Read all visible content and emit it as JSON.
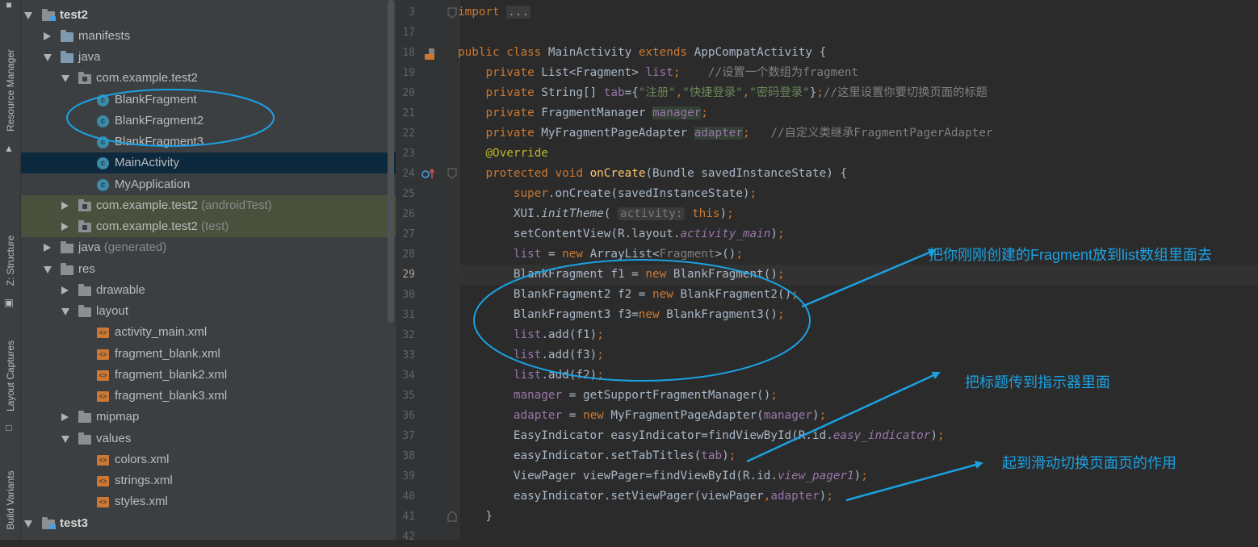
{
  "side_tabs": {
    "resource_manager": "Resource Manager",
    "structure": "Z: Structure",
    "layout_captures": "Layout Captures",
    "build_variants": "Build Variants"
  },
  "tree": {
    "items": [
      {
        "label": "test2",
        "suffix": "",
        "icon": "module-folder-icon"
      },
      {
        "label": "manifests",
        "suffix": "",
        "icon": "folder-icon"
      },
      {
        "label": "java",
        "suffix": "",
        "icon": "folder-icon"
      },
      {
        "label": "com.example.test2",
        "suffix": "",
        "icon": "package-icon"
      },
      {
        "label": "BlankFragment",
        "suffix": "",
        "icon": "class-icon"
      },
      {
        "label": "BlankFragment2",
        "suffix": "",
        "icon": "class-icon"
      },
      {
        "label": "BlankFragment3",
        "suffix": "",
        "icon": "class-icon"
      },
      {
        "label": "MainActivity",
        "suffix": "",
        "icon": "class-icon"
      },
      {
        "label": "MyApplication",
        "suffix": "",
        "icon": "class-icon"
      },
      {
        "label": "com.example.test2",
        "suffix": "(androidTest)",
        "icon": "package-icon"
      },
      {
        "label": "com.example.test2",
        "suffix": "(test)",
        "icon": "package-icon"
      },
      {
        "label": "java",
        "suffix": "(generated)",
        "icon": "generated-folder-icon"
      },
      {
        "label": "res",
        "suffix": "",
        "icon": "res-folder-icon"
      },
      {
        "label": "drawable",
        "suffix": "",
        "icon": "folder-icon"
      },
      {
        "label": "layout",
        "suffix": "",
        "icon": "folder-icon"
      },
      {
        "label": "activity_main.xml",
        "suffix": "",
        "icon": "xml-file-icon"
      },
      {
        "label": "fragment_blank.xml",
        "suffix": "",
        "icon": "xml-file-icon"
      },
      {
        "label": "fragment_blank2.xml",
        "suffix": "",
        "icon": "xml-file-icon"
      },
      {
        "label": "fragment_blank3.xml",
        "suffix": "",
        "icon": "xml-file-icon"
      },
      {
        "label": "mipmap",
        "suffix": "",
        "icon": "folder-icon"
      },
      {
        "label": "values",
        "suffix": "",
        "icon": "folder-icon"
      },
      {
        "label": "colors.xml",
        "suffix": "",
        "icon": "xml-file-icon"
      },
      {
        "label": "strings.xml",
        "suffix": "",
        "icon": "xml-file-icon"
      },
      {
        "label": "styles.xml",
        "suffix": "",
        "icon": "xml-file-icon"
      },
      {
        "label": "test3",
        "suffix": "",
        "icon": "module-folder-icon"
      }
    ]
  },
  "editor": {
    "line_numbers": [
      "3",
      "17",
      "18",
      "19",
      "20",
      "21",
      "22",
      "23",
      "24",
      "25",
      "26",
      "27",
      "28",
      "29",
      "30",
      "31",
      "32",
      "33",
      "34",
      "35",
      "36",
      "37",
      "38",
      "39",
      "40",
      "41",
      "42"
    ],
    "current_line": "29",
    "hint_param": "activity:"
  },
  "annotations": {
    "fragment_list": "把你刚刚创建的Fragment放到list数组里面去",
    "titles": "把标题传到指示器里面",
    "viewpager": "起到滑动切换页面页的作用"
  },
  "colors": {
    "annotation": "#1ba1e2",
    "selection": "#0d293e",
    "test_bg": "#49513c"
  }
}
